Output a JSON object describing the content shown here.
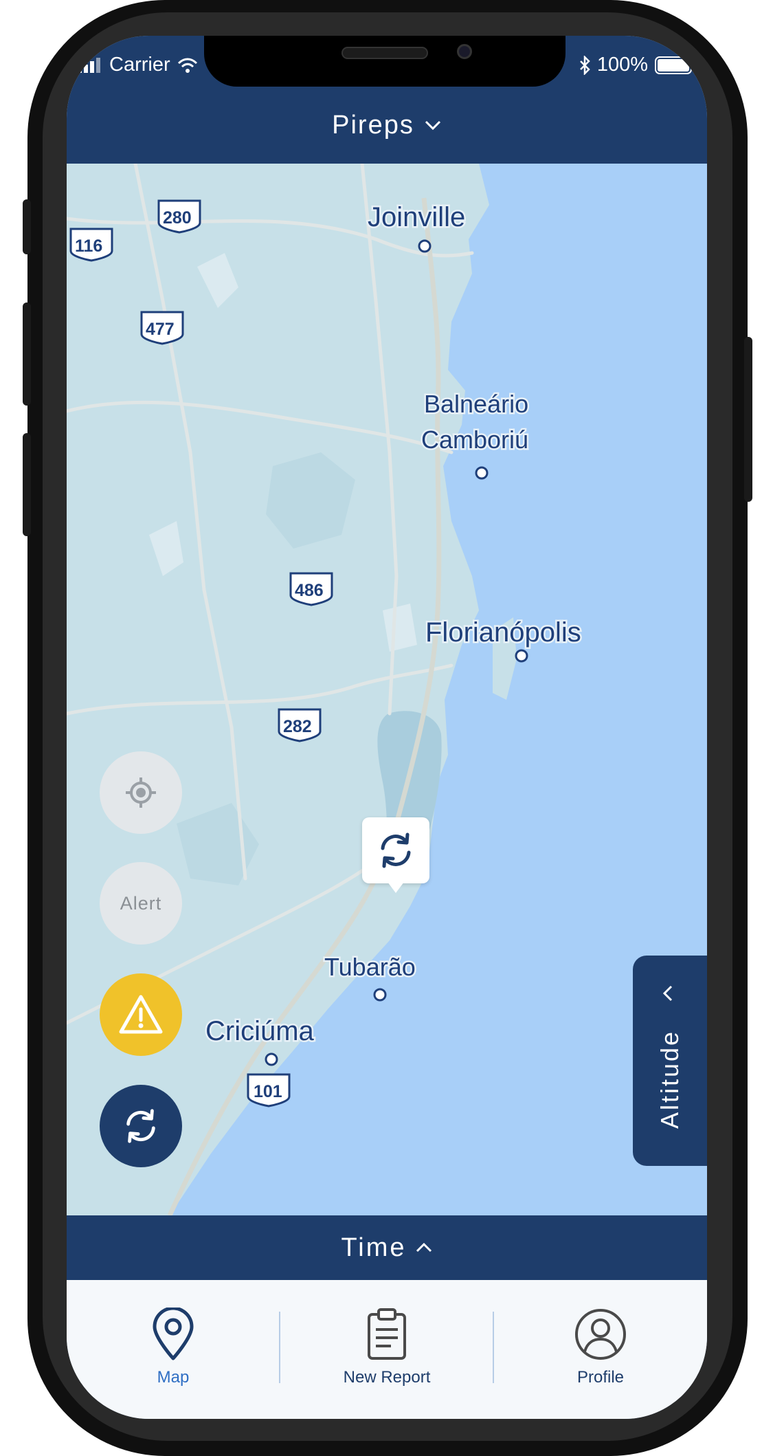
{
  "status_bar": {
    "carrier": "Carrier",
    "battery": "100%"
  },
  "header": {
    "title": "Pireps"
  },
  "map": {
    "cities": [
      "Joinville",
      "Balneário",
      "Camboriú",
      "Florianópolis",
      "Tubarão",
      "Criciúma"
    ],
    "highways": [
      "280",
      "116",
      "477",
      "486",
      "282",
      "101"
    ]
  },
  "controls": {
    "alert_label": "Alert"
  },
  "altitude": {
    "label": "Altitude"
  },
  "time": {
    "label": "Time"
  },
  "tabs": [
    {
      "label": "Map",
      "icon": "map-pin-icon",
      "active": true
    },
    {
      "label": "New Report",
      "icon": "clipboard-icon",
      "active": false
    },
    {
      "label": "Profile",
      "icon": "profile-icon",
      "active": false
    }
  ],
  "colors": {
    "brand_navy": "#1e3d6b",
    "warning_yellow": "#f0c22a",
    "active_tab_blue": "#2f6fc4",
    "water": "#a8cff8",
    "land": "#c7e0e8"
  }
}
